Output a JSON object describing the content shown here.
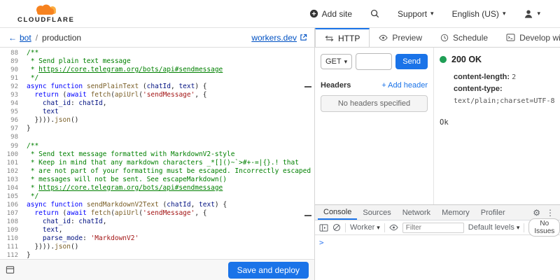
{
  "header": {
    "logo_text": "CLOUDFLARE",
    "add_site": "Add site",
    "support": "Support",
    "language": "English (US)"
  },
  "breadcrumb": {
    "back_arrow": "←",
    "project": "bot",
    "separator": "/",
    "environment": "production",
    "workers_link": "workers.dev"
  },
  "editor": {
    "save_button": "Save and deploy",
    "lines": [
      {
        "n": 88,
        "t": [
          [
            "c",
            "/**"
          ]
        ]
      },
      {
        "n": 89,
        "t": [
          [
            "c",
            " * Send plain text message"
          ]
        ]
      },
      {
        "n": 90,
        "t": [
          [
            "c",
            " * "
          ],
          [
            "l",
            "https://core.telegram.org/bots/api#sendmessage"
          ]
        ]
      },
      {
        "n": 91,
        "t": [
          [
            "c",
            " */"
          ]
        ]
      },
      {
        "n": 92,
        "t": [
          [
            "k",
            "async"
          ],
          [
            "p",
            " "
          ],
          [
            "k",
            "function"
          ],
          [
            "p",
            " "
          ],
          [
            "f",
            "sendPlainText"
          ],
          [
            "p",
            " ("
          ],
          [
            "v",
            "chatId"
          ],
          [
            "p",
            ", "
          ],
          [
            "v",
            "text"
          ],
          [
            "p",
            ") {"
          ]
        ]
      },
      {
        "n": 93,
        "t": [
          [
            "p",
            "  "
          ],
          [
            "k",
            "return"
          ],
          [
            "p",
            " ("
          ],
          [
            "k",
            "await"
          ],
          [
            "p",
            " "
          ],
          [
            "f",
            "fetch"
          ],
          [
            "p",
            "("
          ],
          [
            "f",
            "apiUrl"
          ],
          [
            "p",
            "("
          ],
          [
            "s",
            "'sendMessage'"
          ],
          [
            "p",
            ", {"
          ]
        ]
      },
      {
        "n": 94,
        "t": [
          [
            "p",
            "    "
          ],
          [
            "v",
            "chat_id"
          ],
          [
            "p",
            ": "
          ],
          [
            "v",
            "chatId"
          ],
          [
            "p",
            ","
          ]
        ]
      },
      {
        "n": 95,
        "t": [
          [
            "p",
            "    "
          ],
          [
            "v",
            "text"
          ]
        ]
      },
      {
        "n": 96,
        "t": [
          [
            "p",
            "  })))."
          ],
          [
            "f",
            "json"
          ],
          [
            "p",
            "()"
          ]
        ]
      },
      {
        "n": 97,
        "t": [
          [
            "p",
            "}"
          ]
        ]
      },
      {
        "n": 98,
        "t": []
      },
      {
        "n": 99,
        "t": [
          [
            "c",
            "/**"
          ]
        ]
      },
      {
        "n": 100,
        "t": [
          [
            "c",
            " * Send text message formatted with MarkdownV2-style"
          ]
        ]
      },
      {
        "n": 101,
        "t": [
          [
            "c",
            " * Keep in mind that any markdown characters _*[]()~`>#+-=|{}.! that"
          ]
        ]
      },
      {
        "n": 102,
        "t": [
          [
            "c",
            " * are not part of your formatting must be escaped. Incorrectly escaped"
          ]
        ]
      },
      {
        "n": 103,
        "t": [
          [
            "c",
            " * messages will not be sent. See escapeMarkdown()"
          ]
        ]
      },
      {
        "n": 104,
        "t": [
          [
            "c",
            " * "
          ],
          [
            "l",
            "https://core.telegram.org/bots/api#sendmessage"
          ]
        ]
      },
      {
        "n": 105,
        "t": [
          [
            "c",
            " */"
          ]
        ]
      },
      {
        "n": 106,
        "t": [
          [
            "k",
            "async"
          ],
          [
            "p",
            " "
          ],
          [
            "k",
            "function"
          ],
          [
            "p",
            " "
          ],
          [
            "f",
            "sendMarkdownV2Text"
          ],
          [
            "p",
            " ("
          ],
          [
            "v",
            "chatId"
          ],
          [
            "p",
            ", "
          ],
          [
            "v",
            "text"
          ],
          [
            "p",
            ") {"
          ]
        ]
      },
      {
        "n": 107,
        "t": [
          [
            "p",
            "  "
          ],
          [
            "k",
            "return"
          ],
          [
            "p",
            " ("
          ],
          [
            "k",
            "await"
          ],
          [
            "p",
            " "
          ],
          [
            "f",
            "fetch"
          ],
          [
            "p",
            "("
          ],
          [
            "f",
            "apiUrl"
          ],
          [
            "p",
            "("
          ],
          [
            "s",
            "'sendMessage'"
          ],
          [
            "p",
            ", {"
          ]
        ]
      },
      {
        "n": 108,
        "t": [
          [
            "p",
            "    "
          ],
          [
            "v",
            "chat_id"
          ],
          [
            "p",
            ": "
          ],
          [
            "v",
            "chatId"
          ],
          [
            "p",
            ","
          ]
        ]
      },
      {
        "n": 109,
        "t": [
          [
            "p",
            "    "
          ],
          [
            "v",
            "text"
          ],
          [
            "p",
            ","
          ]
        ]
      },
      {
        "n": 110,
        "t": [
          [
            "p",
            "    "
          ],
          [
            "v",
            "parse_mode"
          ],
          [
            "p",
            ": "
          ],
          [
            "s",
            "'MarkdownV2'"
          ]
        ]
      },
      {
        "n": 111,
        "t": [
          [
            "p",
            "  })))."
          ],
          [
            "f",
            "json"
          ],
          [
            "p",
            "()"
          ]
        ]
      },
      {
        "n": 112,
        "t": [
          [
            "p",
            "}"
          ]
        ]
      }
    ]
  },
  "http_panel": {
    "tabs": [
      "HTTP",
      "Preview",
      "Schedule",
      "Develop with Wrangler CLI"
    ],
    "active_tab": "HTTP",
    "request": {
      "method": "GET",
      "url_value": "",
      "send_button": "Send",
      "headers_label": "Headers",
      "add_header": "+ Add header",
      "no_headers": "No headers specified"
    },
    "response": {
      "status": "200 OK",
      "status_color": "#1f9e55",
      "headers": [
        {
          "name": "content-length",
          "value": "2"
        },
        {
          "name": "content-type",
          "value": "text/plain;charset=UTF-8"
        }
      ],
      "body": "Ok"
    }
  },
  "devtools": {
    "tabs": [
      "Console",
      "Sources",
      "Network",
      "Memory",
      "Profiler"
    ],
    "active_tab": "Console",
    "toolbar": {
      "context": "Worker",
      "filter_placeholder": "Filter",
      "levels": "Default levels",
      "no_issues": "No Issues"
    },
    "prompt": ">"
  },
  "colors": {
    "accent_blue": "#1a73e8",
    "link_blue": "#0051c3",
    "brand_orange": "#f6821f",
    "brand_orange_light": "#fbad41"
  }
}
